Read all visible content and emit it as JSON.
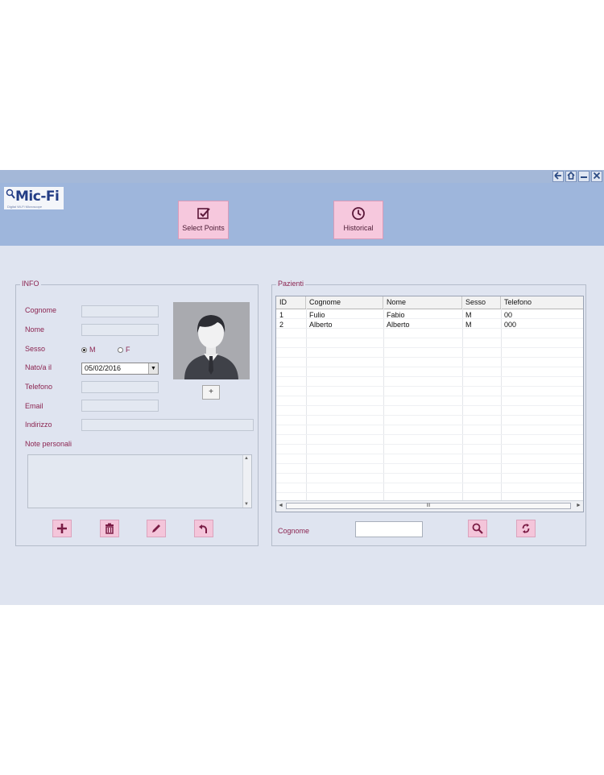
{
  "window": {
    "back_icon": "arrow-left-icon",
    "home_icon": "home-icon",
    "minimize_icon": "minimize-icon",
    "close_icon": "close-icon"
  },
  "logo": {
    "text": "Mic-Fi",
    "subtitle": "Digital Wi-Fi Microscope"
  },
  "toolbar": {
    "select_points_label": "Select Points",
    "historical_label": "Historical"
  },
  "info": {
    "legend": "INFO",
    "cognome_label": "Cognome",
    "nome_label": "Nome",
    "sesso_label": "Sesso",
    "sesso_m": "M",
    "sesso_f": "F",
    "sesso_selected": "M",
    "nato_label": "Nato/a il",
    "nato_value": "05/02/2016",
    "telefono_label": "Telefono",
    "email_label": "Email",
    "indirizzo_label": "Indirizzo",
    "note_label": "Note personali",
    "add_photo_label": "+"
  },
  "pazienti": {
    "legend": "Pazienti",
    "columns": [
      "ID",
      "Cognome",
      "Nome",
      "Sesso",
      "Telefono"
    ],
    "rows": [
      [
        "1",
        "Fulio",
        "Fabio",
        "M",
        "00"
      ],
      [
        "2",
        "Alberto",
        "Alberto",
        "M",
        "000"
      ]
    ],
    "search_label": "Cognome",
    "search_value": "",
    "scroll_thumb_label": "III"
  },
  "colors": {
    "accent": "#8b2450",
    "button_pink": "#f4c5da",
    "header_blue": "#9eb6dc",
    "app_bg": "#dfe4f0"
  }
}
